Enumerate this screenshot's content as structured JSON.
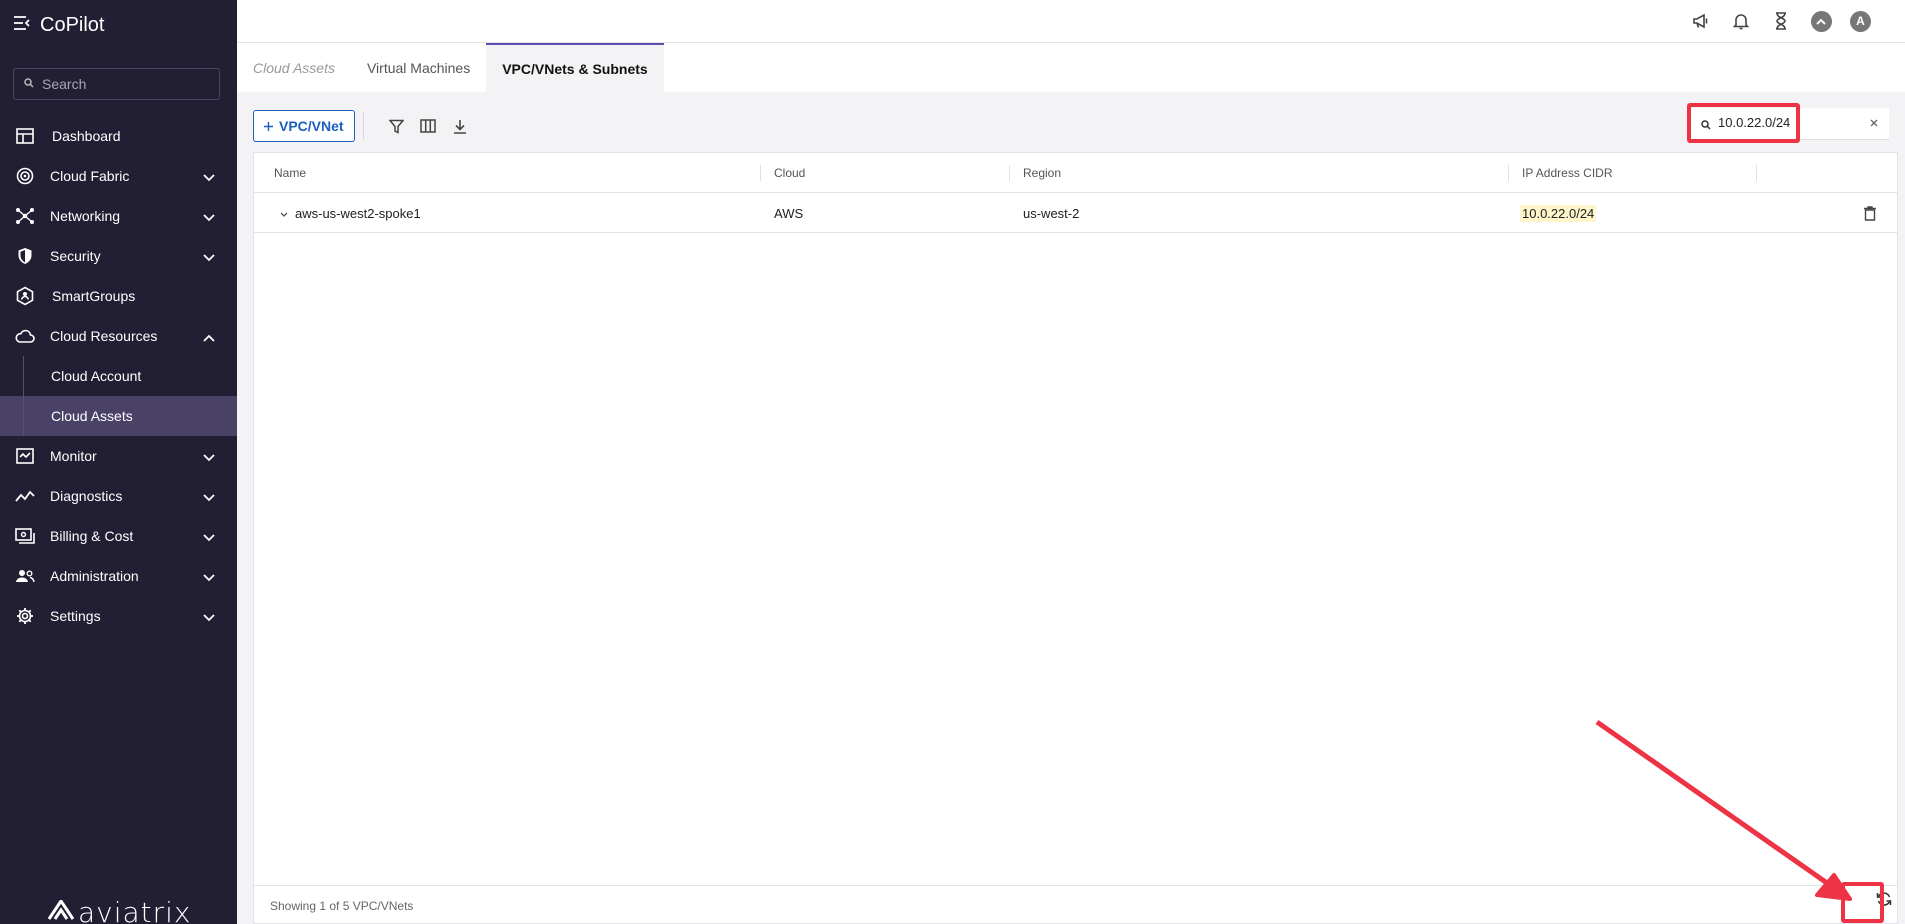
{
  "app": {
    "title": "CoPilot"
  },
  "sidebar": {
    "search_placeholder": "Search",
    "items": [
      {
        "label": "Dashboard",
        "icon": "dashboard-icon"
      },
      {
        "label": "Cloud Fabric",
        "icon": "cloud-fabric-icon"
      },
      {
        "label": "Networking",
        "icon": "networking-icon"
      },
      {
        "label": "Security",
        "icon": "shield-icon"
      },
      {
        "label": "SmartGroups",
        "icon": "smartgroups-icon"
      },
      {
        "label": "Cloud Resources",
        "icon": "cloud-icon"
      },
      {
        "label": "Monitor",
        "icon": "monitor-icon"
      },
      {
        "label": "Diagnostics",
        "icon": "diagnostics-icon"
      },
      {
        "label": "Billing & Cost",
        "icon": "billing-icon"
      },
      {
        "label": "Administration",
        "icon": "users-icon"
      },
      {
        "label": "Settings",
        "icon": "gear-icon"
      }
    ],
    "sub_items": [
      {
        "label": "Cloud Account"
      },
      {
        "label": "Cloud Assets"
      }
    ],
    "logo_text": "aviatrix"
  },
  "topbar": {
    "avatar_letter": "A"
  },
  "tabs": [
    {
      "label": "Cloud Assets"
    },
    {
      "label": "Virtual Machines"
    },
    {
      "label": "VPC/VNets & Subnets"
    }
  ],
  "toolbar": {
    "add_label": "VPC/VNet",
    "filter_value": "10.0.22.0/24"
  },
  "table": {
    "headers": [
      "Name",
      "Cloud",
      "Region",
      "IP Address CIDR"
    ],
    "rows": [
      {
        "name": "aws-us-west2-spoke1",
        "cloud": "AWS",
        "region": "us-west-2",
        "cidr": "10.0.22.0/24"
      }
    ],
    "footer": "Showing 1 of 5 VPC/VNets"
  },
  "colors": {
    "accent": "#1d5fbf",
    "sidebar_bg": "#221e33",
    "highlight": "#ee3344"
  }
}
